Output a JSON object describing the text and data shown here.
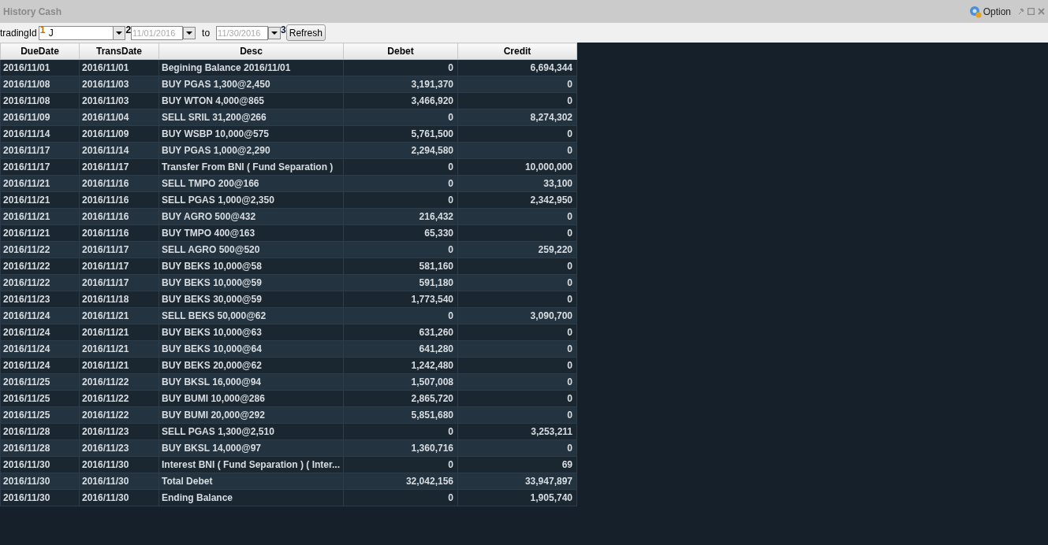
{
  "window": {
    "title": "History Cash",
    "option_label": "Option"
  },
  "toolbar": {
    "trading_label": "tradingId",
    "trading_value": "J",
    "from_date": "11/01/2016",
    "to_label": "to",
    "to_date": "11/30/2016",
    "refresh_label": "Refresh",
    "markers": [
      "1",
      "2",
      "3"
    ]
  },
  "table": {
    "columns": [
      "DueDate",
      "TransDate",
      "Desc",
      "Debet",
      "Credit"
    ],
    "rows": [
      [
        "2016/11/01",
        "2016/11/01",
        "Begining Balance 2016/11/01",
        "0",
        "6,694,344"
      ],
      [
        "2016/11/08",
        "2016/11/03",
        "BUY PGAS 1,300@2,450",
        "3,191,370",
        "0"
      ],
      [
        "2016/11/08",
        "2016/11/03",
        "BUY WTON 4,000@865",
        "3,466,920",
        "0"
      ],
      [
        "2016/11/09",
        "2016/11/04",
        "SELL SRIL 31,200@266",
        "0",
        "8,274,302"
      ],
      [
        "2016/11/14",
        "2016/11/09",
        "BUY WSBP 10,000@575",
        "5,761,500",
        "0"
      ],
      [
        "2016/11/17",
        "2016/11/14",
        "BUY PGAS 1,000@2,290",
        "2,294,580",
        "0"
      ],
      [
        "2016/11/17",
        "2016/11/17",
        "Transfer From BNI ( Fund Separation )",
        "0",
        "10,000,000"
      ],
      [
        "2016/11/21",
        "2016/11/16",
        "SELL TMPO 200@166",
        "0",
        "33,100"
      ],
      [
        "2016/11/21",
        "2016/11/16",
        "SELL PGAS 1,000@2,350",
        "0",
        "2,342,950"
      ],
      [
        "2016/11/21",
        "2016/11/16",
        "BUY AGRO 500@432",
        "216,432",
        "0"
      ],
      [
        "2016/11/21",
        "2016/11/16",
        "BUY TMPO 400@163",
        "65,330",
        "0"
      ],
      [
        "2016/11/22",
        "2016/11/17",
        "SELL AGRO 500@520",
        "0",
        "259,220"
      ],
      [
        "2016/11/22",
        "2016/11/17",
        "BUY BEKS 10,000@58",
        "581,160",
        "0"
      ],
      [
        "2016/11/22",
        "2016/11/17",
        "BUY BEKS 10,000@59",
        "591,180",
        "0"
      ],
      [
        "2016/11/23",
        "2016/11/18",
        "BUY BEKS 30,000@59",
        "1,773,540",
        "0"
      ],
      [
        "2016/11/24",
        "2016/11/21",
        "SELL BEKS 50,000@62",
        "0",
        "3,090,700"
      ],
      [
        "2016/11/24",
        "2016/11/21",
        "BUY BEKS 10,000@63",
        "631,260",
        "0"
      ],
      [
        "2016/11/24",
        "2016/11/21",
        "BUY BEKS 10,000@64",
        "641,280",
        "0"
      ],
      [
        "2016/11/24",
        "2016/11/21",
        "BUY BEKS 20,000@62",
        "1,242,480",
        "0"
      ],
      [
        "2016/11/25",
        "2016/11/22",
        "BUY BKSL 16,000@94",
        "1,507,008",
        "0"
      ],
      [
        "2016/11/25",
        "2016/11/22",
        "BUY BUMI 10,000@286",
        "2,865,720",
        "0"
      ],
      [
        "2016/11/25",
        "2016/11/22",
        "BUY BUMI 20,000@292",
        "5,851,680",
        "0"
      ],
      [
        "2016/11/28",
        "2016/11/23",
        "SELL PGAS 1,300@2,510",
        "0",
        "3,253,211"
      ],
      [
        "2016/11/28",
        "2016/11/23",
        "BUY BKSL 14,000@97",
        "1,360,716",
        "0"
      ],
      [
        "2016/11/30",
        "2016/11/30",
        "Interest BNI ( Fund Separation ) ( Inter...",
        "0",
        "69"
      ],
      [
        "2016/11/30",
        "2016/11/30",
        "Total Debet",
        "32,042,156",
        "33,947,897"
      ],
      [
        "2016/11/30",
        "2016/11/30",
        "Ending Balance",
        "0",
        "1,905,740"
      ]
    ]
  }
}
